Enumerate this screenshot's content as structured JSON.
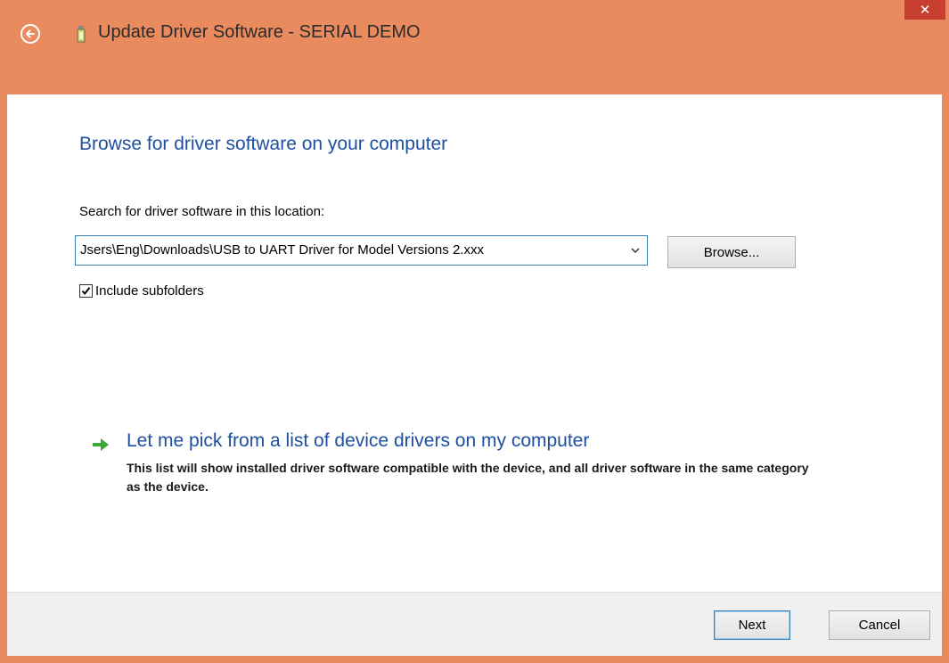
{
  "window": {
    "title": "Update Driver Software - SERIAL DEMO",
    "close_label": "✕",
    "accent_color": "#e98b5f"
  },
  "main": {
    "heading": "Browse for driver software on your computer",
    "search_label": "Search for driver software in this location:",
    "path_value": "Jsers\\Eng\\Downloads\\USB to UART Driver for Model Versions 2.xxx",
    "browse_label": "Browse...",
    "include_subfolders": {
      "label": "Include subfolders",
      "checked": true
    },
    "pick_link": "Let me pick from a list of device drivers on my computer",
    "pick_description": "This list will show installed driver software compatible with the device, and all driver software in the same category as the device."
  },
  "footer": {
    "next_label": "Next",
    "cancel_label": "Cancel"
  },
  "icons": {
    "back": "back-arrow-icon",
    "device": "usb-device-icon",
    "dropdown": "chevron-down-icon",
    "pick": "green-arrow-icon",
    "check": "checkmark-icon"
  }
}
